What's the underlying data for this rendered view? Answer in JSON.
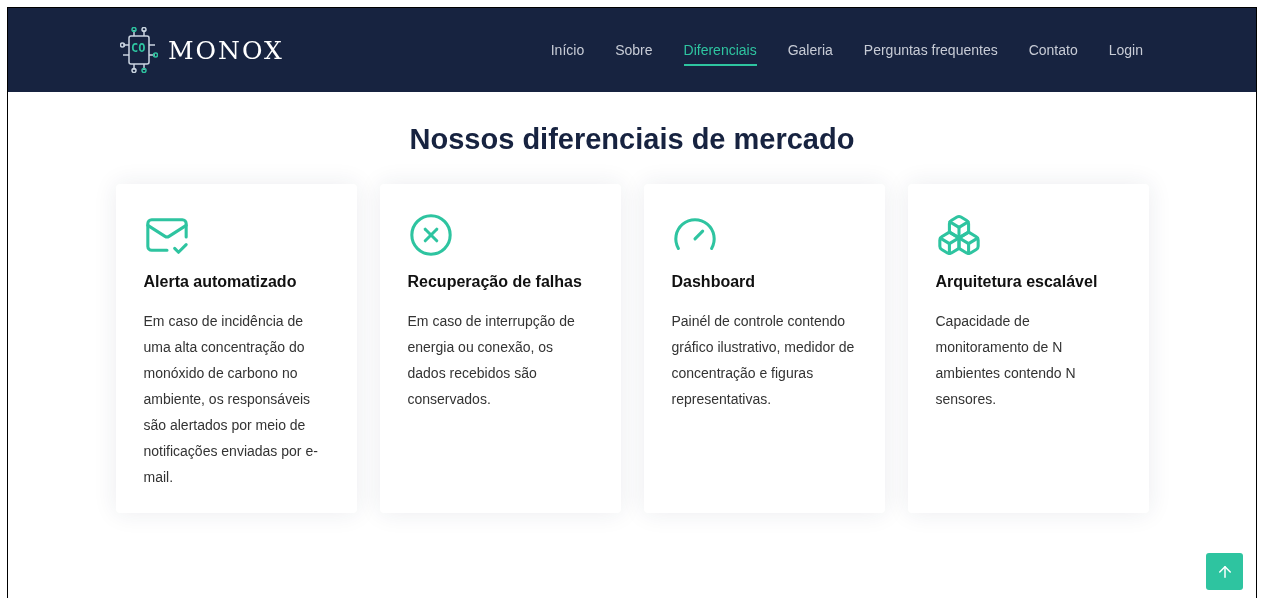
{
  "brand": {
    "name": "MONOX",
    "logo_text": "CO"
  },
  "nav": [
    {
      "label": "Início",
      "selected": false
    },
    {
      "label": "Sobre",
      "selected": false
    },
    {
      "label": "Diferenciais",
      "selected": true
    },
    {
      "label": "Galeria",
      "selected": false
    },
    {
      "label": "Perguntas frequentes",
      "selected": false
    },
    {
      "label": "Contato",
      "selected": false
    },
    {
      "label": "Login",
      "selected": false
    }
  ],
  "section": {
    "title": "Nossos diferenciais de mercado",
    "cards": [
      {
        "kind": "mail",
        "title": "Alerta automatizado",
        "text": "Em caso de incidência de uma alta concentração do monóxido de carbono no ambiente, os responsáveis são alertados por meio de notificações enviadas por e-mail."
      },
      {
        "kind": "cross",
        "title": "Recuperação de falhas",
        "text": "Em caso de interrupção de energia ou conexão, os dados recebidos são conservados."
      },
      {
        "kind": "gauge",
        "title": "Dashboard",
        "text": "Painél de controle contendo gráfico ilustrativo, medidor de concentração e figuras representativas."
      },
      {
        "kind": "cubes",
        "title": "Arquitetura escalável",
        "text": "Capacidade de monitoramento de N ambientes contendo N sensores."
      }
    ]
  }
}
